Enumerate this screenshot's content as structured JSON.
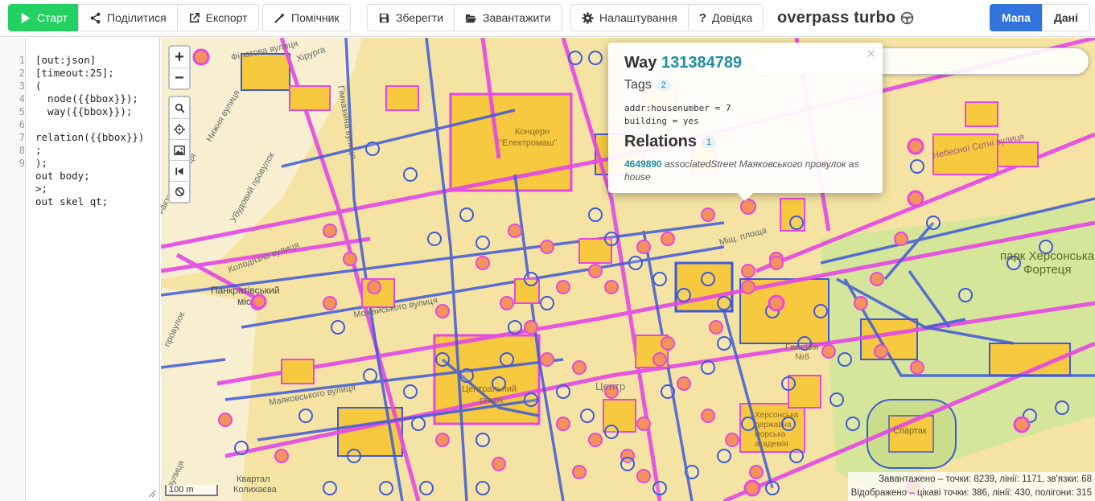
{
  "toolbar": {
    "run": "Старт",
    "share": "Поділитися",
    "export": "Експорт",
    "wizard": "Помічник",
    "save": "Зберегти",
    "load": "Завантажити",
    "settings": "Налаштування",
    "help": "Довідка",
    "app_title": "overpass turbo",
    "tab_map": "Мапа",
    "tab_data": "Дані"
  },
  "editor": {
    "line_numbers": [
      "1",
      "2",
      "3",
      "4",
      "5",
      "6",
      "7",
      "8",
      "9"
    ],
    "lines": [
      "[out:json]",
      "[timeout:25];",
      "(",
      "  node({{bbox}});",
      "  way({{bbox}});",
      "",
      "relation({{bbox}})",
      ";",
      ");",
      "out body;",
      ">;",
      "out skel qt;"
    ]
  },
  "map": {
    "zoom_in": "+",
    "zoom_out": "−",
    "scale": "100 m",
    "labels": {
      "street_filatova": "Філатова вулиця",
      "street_khirurha": "Хірурга",
      "street_nyzhnia": "Нижня вулиця",
      "street_faktorna": "Факторна вулиця",
      "street_ubudovyi": "Убудовий провулок",
      "street_koliadna": "Колодязна вулиця",
      "street_provulok": "провулок",
      "street_bottom": "вулиця",
      "pankrativskyi": "Панкратівський",
      "pankrativskyi2": "міс",
      "kontsern": "Концерн",
      "elektromash": "\"Електромаш\"",
      "central_market": "Центральний",
      "central_market2": "ринок",
      "tsentr": "Центр",
      "gymnasium": "Гімназія",
      "gymnasium2": "№6",
      "mayakovskoho": "Маяковського вулиця",
      "mozhaiskoho": "Можайського вулиця",
      "nebesnoi_sotni": "Небесної Сотні вулиця",
      "kherson_state": "Херсонська",
      "kherson_state2": "державна",
      "kherson_state3": "морська",
      "kherson_state4": "академія",
      "park": "парк Херсонська",
      "park2": "Фортеця",
      "spartak": "Спартак",
      "kvartal": "Квартал",
      "kvartal2": "Колихаєва",
      "mistsevosti": "Міщ. площа",
      "gimnaziina": "Гімназійна вулиця"
    }
  },
  "search": {
    "value": "",
    "placeholder": ""
  },
  "popup": {
    "type": "Way",
    "id": "131384789",
    "tags_title": "Tags",
    "tags_count": "2",
    "tags": [
      "addr:housenumber = 7",
      "building = yes"
    ],
    "relations_title": "Relations",
    "relations_count": "1",
    "relation_id": "4649890",
    "relation_text": "associatedStreet Маяковського провулок as house"
  },
  "stats": {
    "loaded": "Завантажено – точки: 8239, лінії: 1171, зв'язки: 68",
    "displayed": "Відображено – цікаві точки: 386, лінії: 430, полігони: 315"
  },
  "colors": {
    "run_green": "#23d160",
    "active_blue": "#3273dc",
    "map_base": "#f4e3a2",
    "building_fill": "#f6c93e",
    "way_blue": "#3f5ad8",
    "highlight_magenta": "#e548e6",
    "poi_orange": "#f39359",
    "park_green": "#d5e59a",
    "link_teal": "#1f8ea3"
  }
}
